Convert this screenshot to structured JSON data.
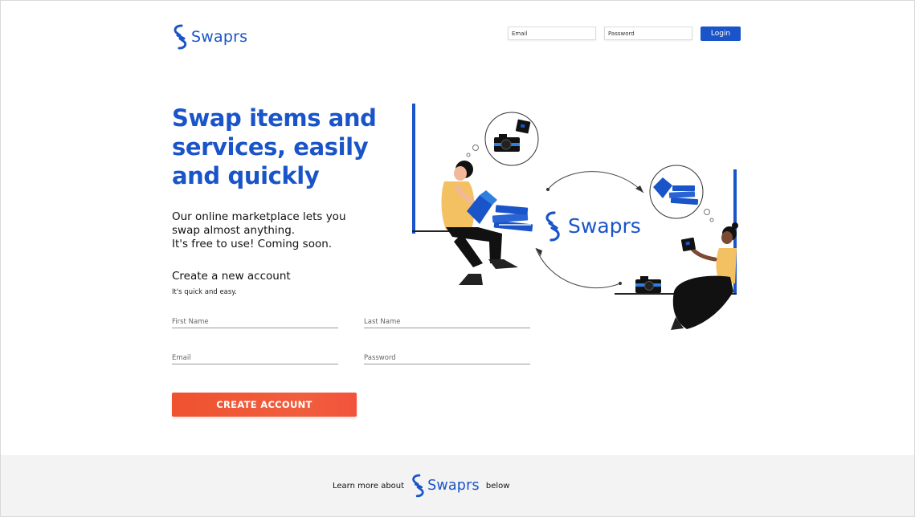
{
  "brand": {
    "name": "Swaprs",
    "color": "#1a54c9",
    "logo_icon": "chain-link-s-icon"
  },
  "header": {
    "email_placeholder": "Email",
    "password_placeholder": "Password",
    "login_label": "Login"
  },
  "hero": {
    "headline": "Swap items and services, easily and quickly",
    "subtext_line1": "Our online marketplace lets you",
    "subtext_line2": "swap almost anything.",
    "subtext_line3": "It's free to use! Coming soon."
  },
  "signup": {
    "title": "Create a new account",
    "subtitle": "It's quick and easy.",
    "first_name_placeholder": "First Name",
    "last_name_placeholder": "Last Name",
    "email_placeholder": "Email",
    "password_placeholder": "Password",
    "submit_label": "CREATE ACCOUNT",
    "button_color": "#ef5230"
  },
  "footer": {
    "text_before": "Learn more about",
    "text_after": "below"
  },
  "illustration": {
    "logo_text": "Swaprs",
    "items": [
      "camera-icon",
      "books-icon",
      "tablet-icon"
    ]
  }
}
